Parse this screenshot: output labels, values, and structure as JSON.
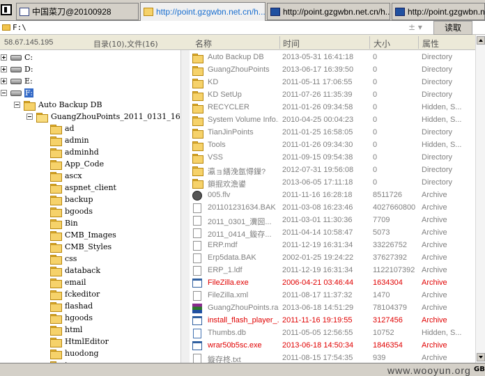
{
  "tabs": [
    {
      "label": "中国菜刀@20100928",
      "active": false
    },
    {
      "label": "http://point.gzgwbn.net.cn/h...",
      "active": true
    },
    {
      "label": "http://point.gzgwbn.net.cn/h...",
      "active": false
    },
    {
      "label": "http://point.gzgwbn.net.cn/h...",
      "active": false
    }
  ],
  "pathbar": {
    "path": "F:\\",
    "controls": "±  ▾",
    "read_button": "读取"
  },
  "left": {
    "ip": "58.67.145.195",
    "dir_count": "目录(10),文件(16)",
    "tree": [
      {
        "label": "C:",
        "kind": "drive",
        "expander": "plus"
      },
      {
        "label": "D:",
        "kind": "drive",
        "expander": "plus"
      },
      {
        "label": "E:",
        "kind": "drive",
        "expander": "plus"
      },
      {
        "label": "F:",
        "kind": "drive",
        "expander": "minus",
        "selected": true
      },
      {
        "label": "Auto Backup DB",
        "kind": "folder",
        "expander": "minus"
      },
      {
        "label": "GuangZhouPoints_2011_0131_1624",
        "kind": "folder-open",
        "expander": "minus"
      },
      {
        "label": "ad",
        "kind": "folder"
      },
      {
        "label": "admin",
        "kind": "folder"
      },
      {
        "label": "adminhd",
        "kind": "folder"
      },
      {
        "label": "App_Code",
        "kind": "folder"
      },
      {
        "label": "ascx",
        "kind": "folder"
      },
      {
        "label": "aspnet_client",
        "kind": "folder"
      },
      {
        "label": "backup",
        "kind": "folder"
      },
      {
        "label": "bgoods",
        "kind": "folder"
      },
      {
        "label": "Bin",
        "kind": "folder"
      },
      {
        "label": "CMB_Images",
        "kind": "folder"
      },
      {
        "label": "CMB_Styles",
        "kind": "folder"
      },
      {
        "label": "css",
        "kind": "folder"
      },
      {
        "label": "databack",
        "kind": "folder"
      },
      {
        "label": "email",
        "kind": "folder"
      },
      {
        "label": "fckeditor",
        "kind": "folder"
      },
      {
        "label": "flashad",
        "kind": "folder"
      },
      {
        "label": "hgoods",
        "kind": "folder"
      },
      {
        "label": "html",
        "kind": "folder"
      },
      {
        "label": "HtmlEditor",
        "kind": "folder"
      },
      {
        "label": "huodong",
        "kind": "folder"
      },
      {
        "label": "i...",
        "kind": "folder"
      }
    ]
  },
  "columns": {
    "name": "名称",
    "time": "时间",
    "size": "大小",
    "attr": "属性"
  },
  "files": [
    {
      "name": "Auto Backup DB",
      "time": "2013-05-31 16:41:18",
      "size": "0",
      "attr": "Directory",
      "icon": "folder-icon",
      "red": false
    },
    {
      "name": "GuangZhouPoints",
      "time": "2013-06-17 16:39:50",
      "size": "0",
      "attr": "Directory",
      "icon": "folder-icon",
      "red": false
    },
    {
      "name": "KD",
      "time": "2011-05-11 17:06:55",
      "size": "0",
      "attr": "Directory",
      "icon": "folder-icon",
      "red": false
    },
    {
      "name": "KD SetUp",
      "time": "2011-07-26 11:35:39",
      "size": "0",
      "attr": "Directory",
      "icon": "folder-icon",
      "red": false
    },
    {
      "name": "RECYCLER",
      "time": "2011-01-26 09:34:58",
      "size": "0",
      "attr": "Hidden, S...",
      "icon": "folder-icon",
      "red": false
    },
    {
      "name": "System Volume Info...",
      "time": "2010-04-25 00:04:23",
      "size": "0",
      "attr": "Hidden, S...",
      "icon": "folder-icon",
      "red": false
    },
    {
      "name": "TianJinPoints",
      "time": "2011-01-25 16:58:05",
      "size": "0",
      "attr": "Directory",
      "icon": "folder-icon",
      "red": false
    },
    {
      "name": "Tools",
      "time": "2011-01-26 09:34:30",
      "size": "0",
      "attr": "Hidden, S...",
      "icon": "folder-icon",
      "red": false
    },
    {
      "name": "VSS",
      "time": "2011-09-15 09:54:38",
      "size": "0",
      "attr": "Directory",
      "icon": "folder-icon",
      "red": false
    },
    {
      "name": "瀛ョ繕浼氬憳鏁?",
      "time": "2012-07-31 19:56:08",
      "size": "0",
      "attr": "Directory",
      "icon": "folder-icon",
      "red": false
    },
    {
      "name": "鎖掍欢澹鍙",
      "time": "2013-06-05 17:11:18",
      "size": "0",
      "attr": "Directory",
      "icon": "folder-icon",
      "red": false
    },
    {
      "name": "005.flv",
      "time": "2011-11-16 16:28:18",
      "size": "8511726",
      "attr": "Archive",
      "icon": "flv-icon",
      "red": false
    },
    {
      "name": "201101231634.BAK",
      "time": "2011-03-08 16:23:46",
      "size": "4027660800",
      "attr": "Archive",
      "icon": "file-icon",
      "red": false
    },
    {
      "name": "2011_0301_瀵圀...",
      "time": "2011-03-01 11:30:36",
      "size": "7709",
      "attr": "Archive",
      "icon": "file-icon",
      "red": false
    },
    {
      "name": "2011_0414_鏇存...",
      "time": "2011-04-14 10:58:47",
      "size": "5073",
      "attr": "Archive",
      "icon": "file-icon",
      "red": false
    },
    {
      "name": "ERP.mdf",
      "time": "2011-12-19 16:31:34",
      "size": "33226752",
      "attr": "Archive",
      "icon": "file-icon",
      "red": false
    },
    {
      "name": "Erp5data.BAK",
      "time": "2002-01-25 19:24:22",
      "size": "37627392",
      "attr": "Archive",
      "icon": "file-icon",
      "red": false
    },
    {
      "name": "ERP_1.ldf",
      "time": "2011-12-19 16:31:34",
      "size": "1122107392",
      "attr": "Archive",
      "icon": "file-icon",
      "red": false
    },
    {
      "name": "FileZilla.exe",
      "time": "2006-04-21 03:46:44",
      "size": "1634304",
      "attr": "Archive",
      "icon": "exe-icon",
      "red": true
    },
    {
      "name": "FileZilla.xml",
      "time": "2011-08-17 11:37:32",
      "size": "1470",
      "attr": "Archive",
      "icon": "file-icon",
      "red": false
    },
    {
      "name": "GuangZhouPoints.rar",
      "time": "2013-06-18 14:51:29",
      "size": "78104379",
      "attr": "Archive",
      "icon": "rar-icon",
      "red": false
    },
    {
      "name": "install_flash_player_...",
      "time": "2011-11-16 19:19:55",
      "size": "3127456",
      "attr": "Archive",
      "icon": "exe-icon",
      "red": true
    },
    {
      "name": "Thumbs.db",
      "time": "2011-05-05 12:56:55",
      "size": "10752",
      "attr": "Hidden, S...",
      "icon": "db-icon",
      "red": false
    },
    {
      "name": "wrar50b5sc.exe",
      "time": "2013-06-18 14:50:34",
      "size": "1846354",
      "attr": "Archive",
      "icon": "exe-icon",
      "red": true
    },
    {
      "name": "鏇存柊.txt",
      "time": "2011-08-15 17:54:35",
      "size": "939",
      "attr": "Archive",
      "icon": "file-icon",
      "red": false
    }
  ],
  "status": {
    "watermark": "www.wooyun.org",
    "encoding": "GB"
  }
}
